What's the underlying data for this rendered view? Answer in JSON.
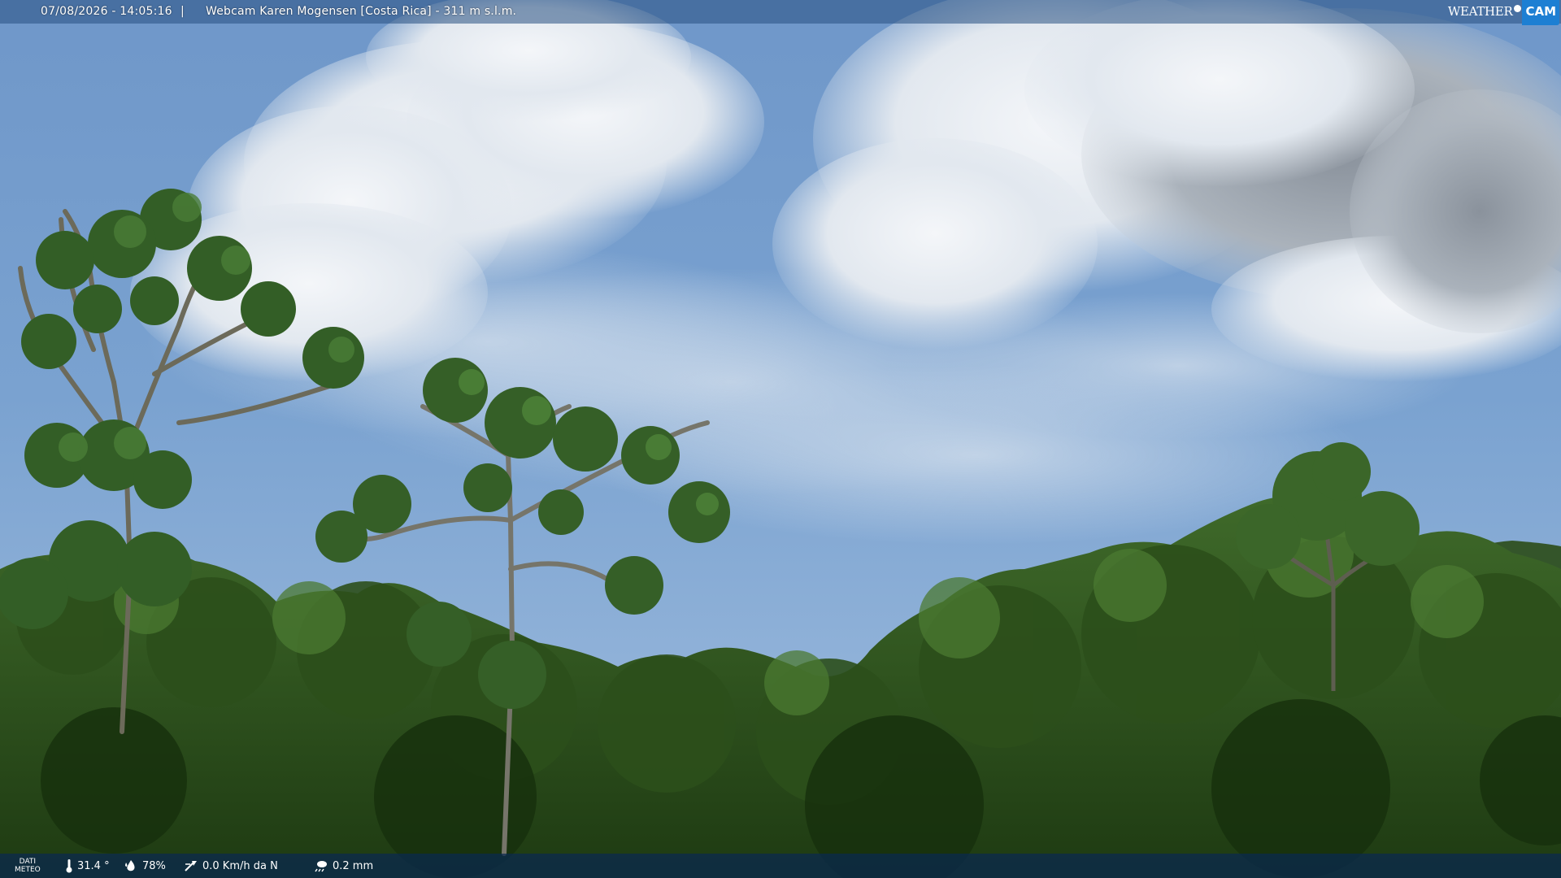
{
  "overlay": {
    "timestamp": "07/08/2026 - 14:05:16",
    "separator": "|",
    "camera_title": "Webcam Karen Mogensen [Costa Rica] - 311 m s.l.m.",
    "logo": {
      "weather": "WEATHER",
      "cam": "CAM"
    }
  },
  "weather_data": {
    "label_line1": "DATI",
    "label_line2": "METEO",
    "temperature": "31.4 °",
    "humidity": "78%",
    "wind": "0.0 Km/h da N",
    "rain": "0.2 mm"
  },
  "colors": {
    "sky": "#5a86c0",
    "cloud": "#e9eef4",
    "foliage": "#2f5a1e",
    "logo_accent": "#1d7fd3",
    "bar": "#0a2850"
  },
  "icons": {
    "temperature": "thermometer-icon",
    "humidity": "droplet-icon",
    "wind": "wind-icon",
    "rain": "rain-cloud-icon"
  }
}
